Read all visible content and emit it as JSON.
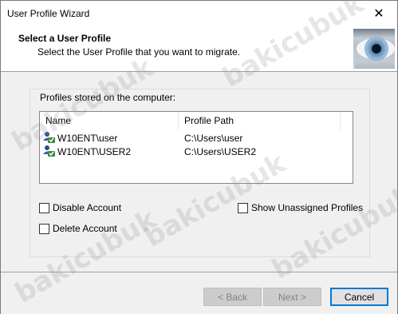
{
  "window": {
    "title": "User Profile Wizard"
  },
  "header": {
    "title": "Select a User Profile",
    "subtitle": "Select the User Profile that you want to migrate."
  },
  "profiles": {
    "group_label": "Profiles stored on the computer:",
    "columns": [
      "Name",
      "Profile Path"
    ],
    "rows": [
      {
        "name": "W10ENT\\user",
        "path": "C:\\Users\\user",
        "icon": "user-profile-icon"
      },
      {
        "name": "W10ENT\\USER2",
        "path": "C:\\Users\\USER2",
        "icon": "user-profile-icon"
      }
    ]
  },
  "options": {
    "disable_account": {
      "label": "Disable Account",
      "checked": false
    },
    "delete_account": {
      "label": "Delete Account",
      "checked": false
    },
    "show_unassigned": {
      "label": "Show Unassigned Profiles",
      "checked": false
    }
  },
  "footer": {
    "back_label": "< Back",
    "next_label": "Next >",
    "cancel_label": "Cancel"
  },
  "watermark": "bakicubuk"
}
